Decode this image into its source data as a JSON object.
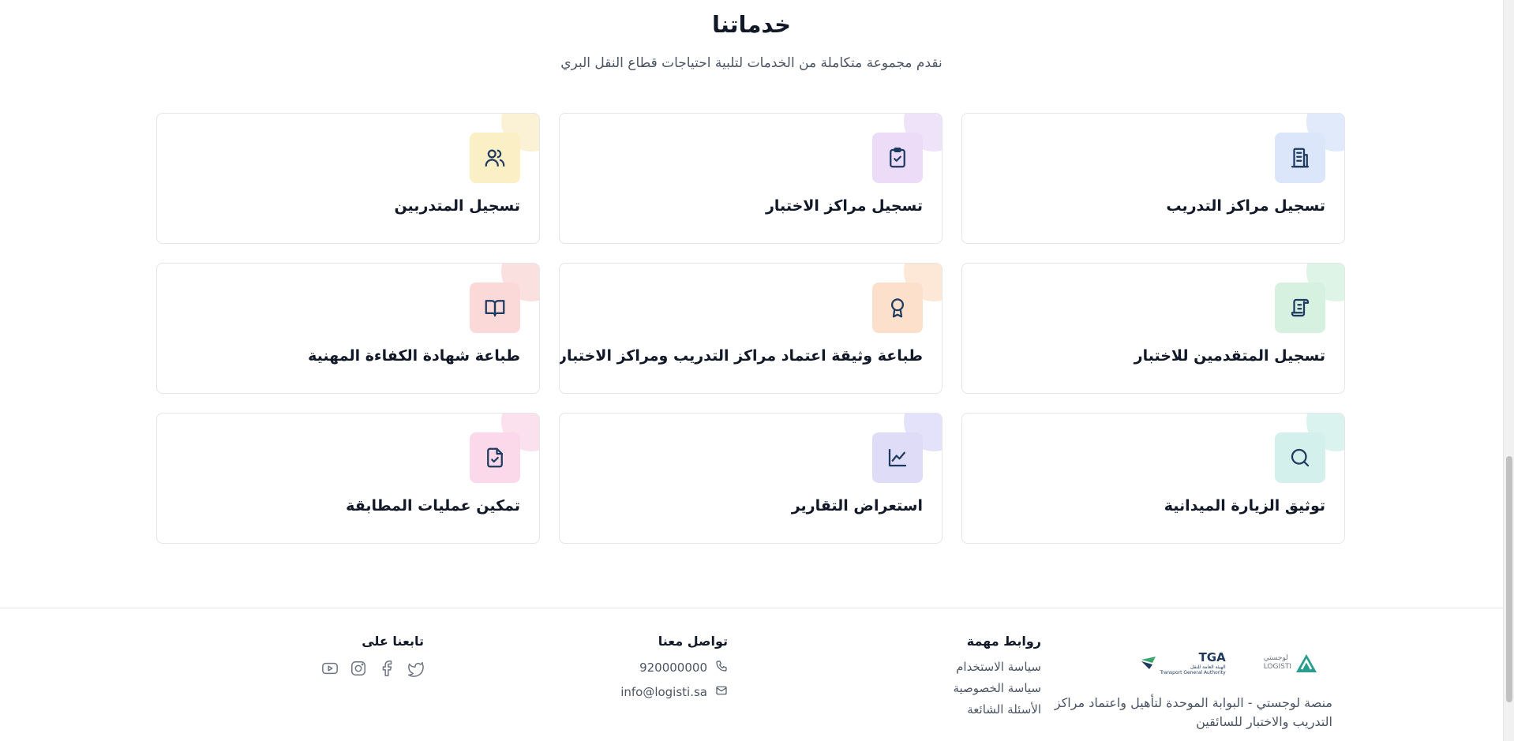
{
  "services": {
    "title": "خدماتنا",
    "subtitle": "نقدم مجموعة متكاملة من الخدمات لتلبية احتياجات قطاع النقل البري",
    "cards": [
      {
        "label": "تسجيل مراكز التدريب",
        "icon": "building-icon",
        "color": "#dbe6fb"
      },
      {
        "label": "تسجيل مراكز الاختبار",
        "icon": "clipboard-check-icon",
        "color": "#ecdcf8"
      },
      {
        "label": "تسجيل المتدربين",
        "icon": "users-icon",
        "color": "#fbefc6"
      },
      {
        "label": "تسجيل المتقدمين للاختبار",
        "icon": "scroll-icon",
        "color": "#d6f1e0"
      },
      {
        "label": "طباعة وثيقة اعتماد مراكز التدريب ومراكز الاختبار",
        "icon": "award-icon",
        "color": "#fde0cb"
      },
      {
        "label": "طباعة شهادة الكفاءة المهنية",
        "icon": "book-open-icon",
        "color": "#fbd9d9"
      },
      {
        "label": "توثيق الزيارة الميدانية",
        "icon": "search-icon",
        "color": "#d3f0ec"
      },
      {
        "label": "استعراض التقارير",
        "icon": "chart-line-icon",
        "color": "#dfdcf8"
      },
      {
        "label": "تمكين عمليات المطابقة",
        "icon": "file-check-icon",
        "color": "#fbd9ea"
      }
    ]
  },
  "footer": {
    "brand": {
      "logistiArabic": "لوجستي",
      "logistiLatin": "LOGISTI",
      "tgaShort": "TGA",
      "tgaArabic": "الهيئة العامة للنقل",
      "tgaEnglish": "Transport General Authority",
      "description": "منصة لوجستي - البوابة الموحدة لتأهيل واعتماد مراكز التدريب والاختبار للسائقين"
    },
    "links": {
      "title": "روابط مهمة",
      "items": [
        "سياسة الاستخدام",
        "سياسة الخصوصية",
        "الأسئلة الشائعة"
      ]
    },
    "contact": {
      "title": "تواصل معنا",
      "phone": "920000000",
      "email": "info@logisti.sa"
    },
    "social": {
      "title": "تابعنا على",
      "icons": [
        "twitter-icon",
        "facebook-icon",
        "instagram-icon",
        "youtube-icon"
      ]
    }
  }
}
